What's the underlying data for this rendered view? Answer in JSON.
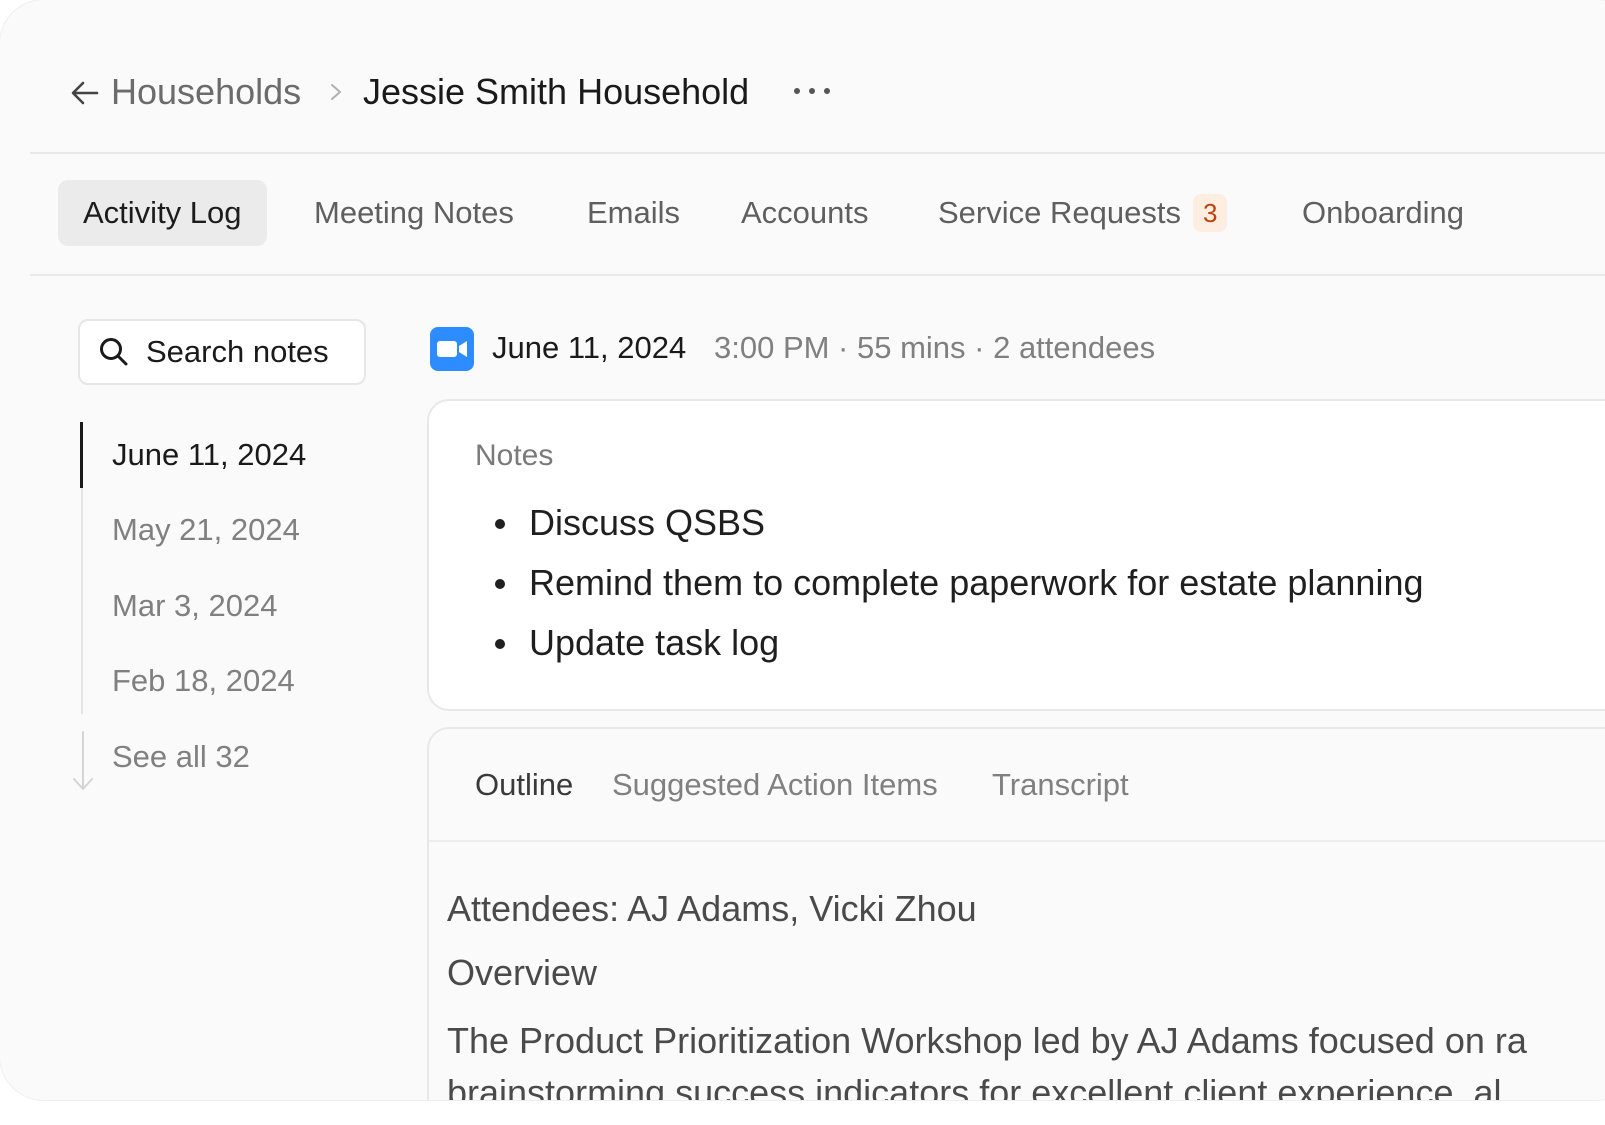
{
  "header": {
    "back_icon": "arrow-left-icon",
    "parent_label": "Households",
    "separator_icon": "chevron-right-icon",
    "current_label": "Jessie Smith Household",
    "more_icon": "more-horizontal-icon"
  },
  "tabs": [
    {
      "label": "Activity Log",
      "active": true
    },
    {
      "label": "Meeting Notes"
    },
    {
      "label": "Emails"
    },
    {
      "label": "Accounts"
    },
    {
      "label": "Service Requests",
      "badge": "3"
    },
    {
      "label": "Onboarding"
    }
  ],
  "sidebar": {
    "search_label": "Search notes",
    "dates": [
      {
        "label": "June 11, 2024",
        "active": true
      },
      {
        "label": "May 21, 2024"
      },
      {
        "label": "Mar 3, 2024"
      },
      {
        "label": "Feb 18, 2024"
      }
    ],
    "see_all": "See all 32"
  },
  "meeting": {
    "icon": "zoom-video-icon",
    "date": "June 11, 2024",
    "meta": "3:00 PM · 55 mins · 2 attendees"
  },
  "notes": {
    "title": "Notes",
    "items": [
      "Discuss QSBS",
      "Remind them to complete paperwork for estate planning",
      "Update task log"
    ]
  },
  "outline": {
    "tabs": [
      {
        "label": "Outline",
        "active": true
      },
      {
        "label": "Suggested Action Items"
      },
      {
        "label": "Transcript"
      }
    ],
    "attendees": "Attendees: AJ Adams, Vicki Zhou",
    "heading": "Overview",
    "body_lines": [
      "The Product Prioritization Workshop led by AJ Adams focused on ra",
      "brainstorming success indicators for excellent client experience, al"
    ]
  },
  "colors": {
    "badge_bg": "#fdeee1",
    "badge_text": "#c2410c",
    "zoom_blue": "#2d8cff"
  }
}
